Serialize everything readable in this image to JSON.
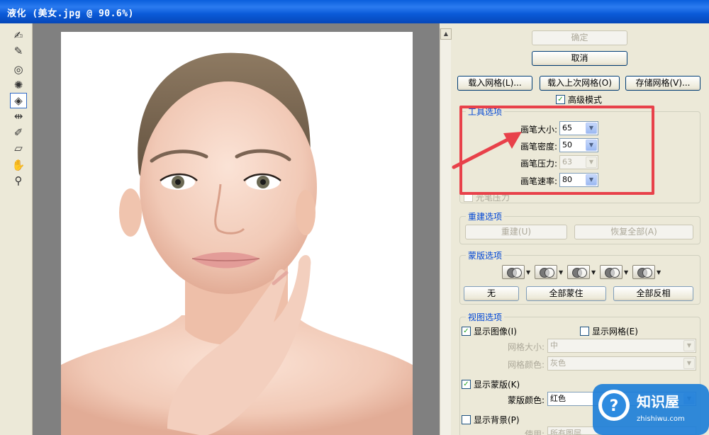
{
  "window": {
    "title": "液化 (美女.jpg @ 90.6%)"
  },
  "toolbox": {
    "tools": [
      {
        "name": "forward-warp-tool",
        "glyph": "✍"
      },
      {
        "name": "reconstruct-tool",
        "glyph": "✎"
      },
      {
        "name": "twirl-clockwise-tool",
        "glyph": "◎"
      },
      {
        "name": "pucker-tool",
        "glyph": "✺"
      },
      {
        "name": "bloat-tool",
        "glyph": "◈"
      },
      {
        "name": "push-left-tool",
        "glyph": "⇹"
      },
      {
        "name": "freeze-mask-tool",
        "glyph": "✐"
      },
      {
        "name": "thaw-mask-tool",
        "glyph": "▱"
      },
      {
        "name": "hand-tool",
        "glyph": "✋"
      },
      {
        "name": "zoom-tool",
        "glyph": "⚲"
      }
    ]
  },
  "buttons": {
    "ok": "确定",
    "cancel": "取消",
    "load_mesh": "载入网格(L)...",
    "load_last_mesh": "载入上次网格(O)",
    "save_mesh": "存储网格(V)..."
  },
  "advanced_mode": {
    "label": "高级模式",
    "checked": true
  },
  "tool_options": {
    "title": "工具选项",
    "brush_size": {
      "label": "画笔大小:",
      "value": "65"
    },
    "brush_density": {
      "label": "画笔密度:",
      "value": "50"
    },
    "brush_pressure": {
      "label": "画笔压力:",
      "value": "63"
    },
    "brush_rate": {
      "label": "画笔速率:",
      "value": "80"
    },
    "stylus_pressure": {
      "label": "光笔压力"
    }
  },
  "reconstruct_options": {
    "title": "重建选项",
    "reconstruct": "重建(U)",
    "restore_all": "恢复全部(A)"
  },
  "mask_options": {
    "title": "蒙版选项",
    "none": "无",
    "mask_all": "全部蒙住",
    "invert_all": "全部反相"
  },
  "view_options": {
    "title": "视图选项",
    "show_image": {
      "label": "显示图像(I)",
      "checked": true
    },
    "show_mesh": {
      "label": "显示网格(E)",
      "checked": false
    },
    "mesh_size": {
      "label": "网格大小:",
      "value": "中"
    },
    "mesh_color": {
      "label": "网格颜色:",
      "value": "灰色"
    },
    "show_mask": {
      "label": "显示蒙版(K)",
      "checked": true
    },
    "mask_color": {
      "label": "蒙版颜色:",
      "value": "红色"
    },
    "show_backdrop": {
      "label": "显示背景(P)",
      "checked": false
    },
    "use": {
      "label": "使用:",
      "value": "所有图层"
    }
  },
  "watermark": {
    "brand": "知识屋",
    "url": "zhishiwu.com"
  },
  "colors": {
    "title_bar": "#0a5ad8",
    "legend": "#0046d5",
    "highlight": "#e8414a",
    "canvas_bg": "#808080"
  }
}
